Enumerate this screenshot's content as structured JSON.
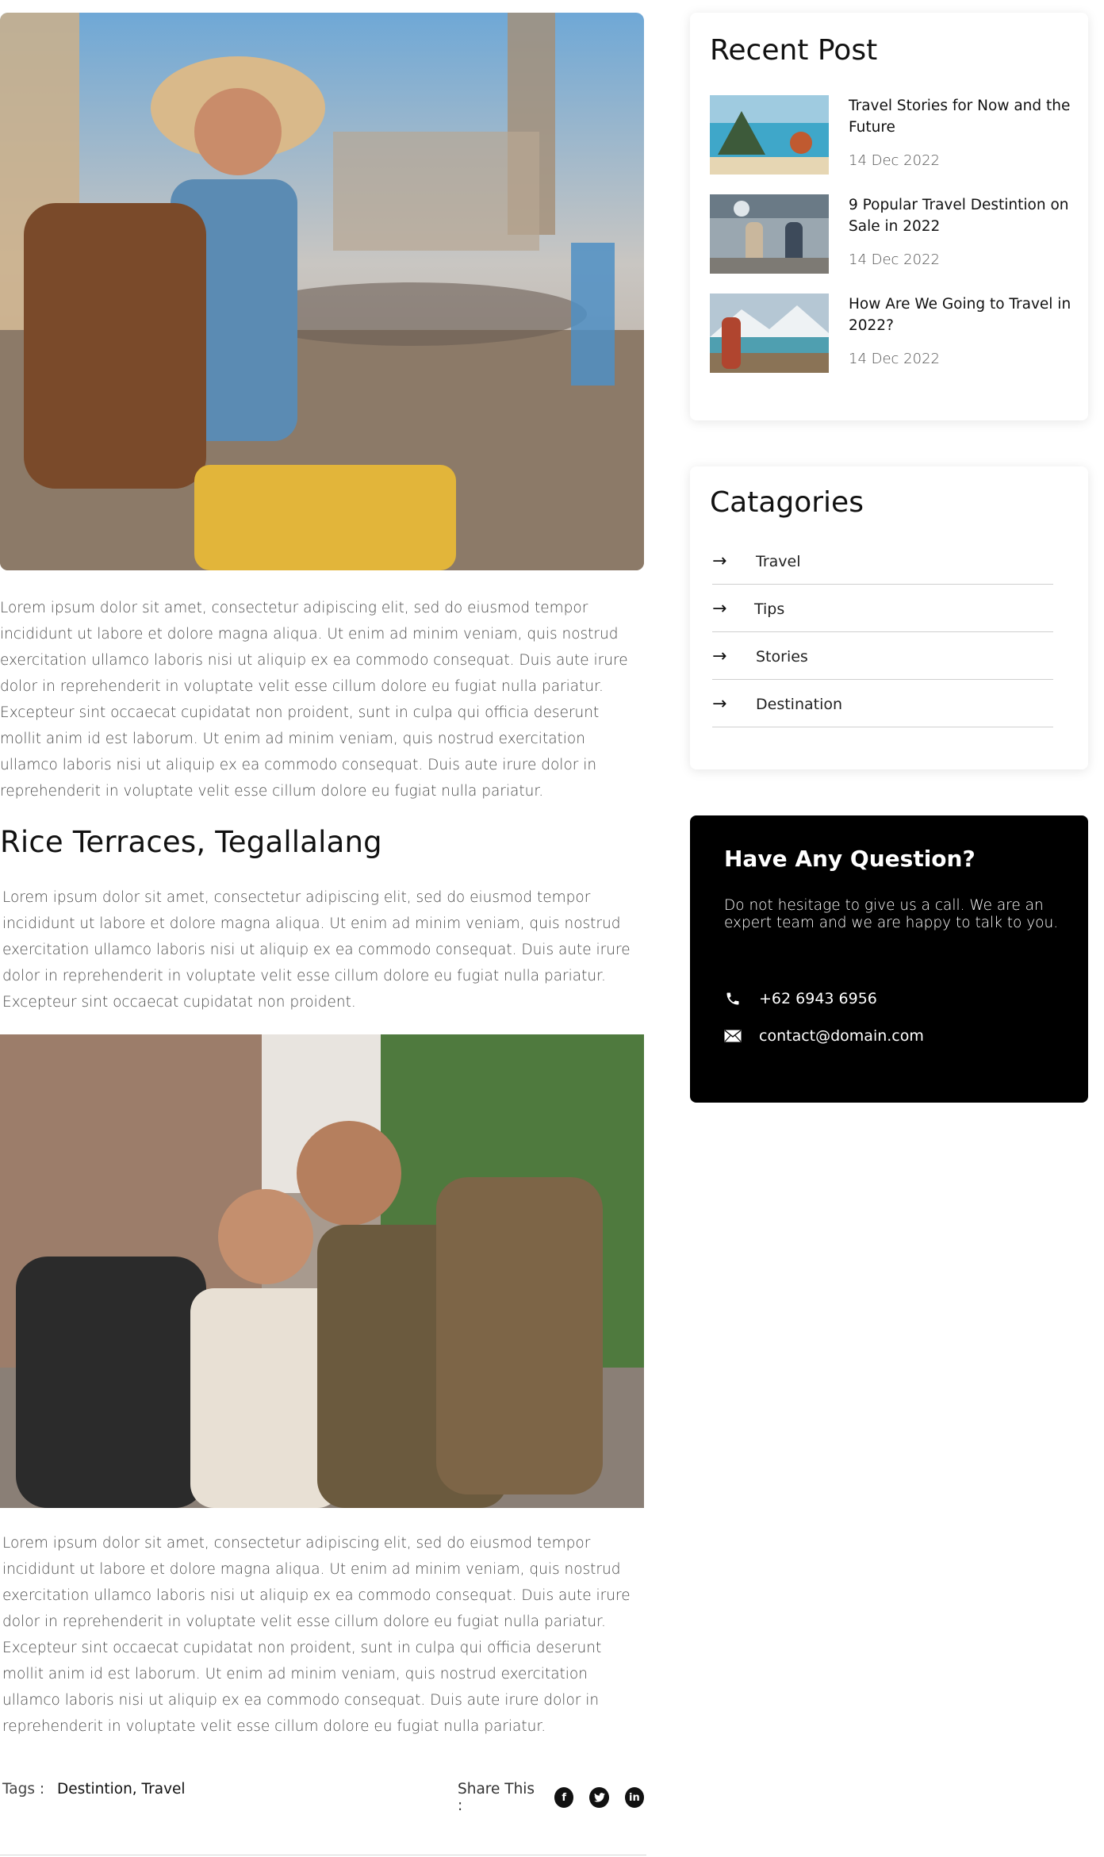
{
  "article": {
    "paragraph_1": "Lorem ipsum dolor sit amet, consectetur adipiscing elit, sed do eiusmod tempor incididunt ut labore et dolore magna aliqua. Ut enim ad minim veniam, quis nostrud exercitation ullamco laboris nisi ut aliquip ex ea commodo consequat. Duis aute irure dolor in reprehenderit in voluptate velit esse cillum dolore eu fugiat nulla pariatur. Excepteur sint occaecat cupidatat non proident, sunt in culpa qui officia deserunt mollit anim id est laborum. Ut enim ad minim veniam, quis nostrud exercitation ullamco laboris nisi ut aliquip ex ea commodo consequat. Duis aute irure dolor in reprehenderit in voluptate velit esse cillum dolore eu fugiat nulla pariatur.",
    "section_heading": "Rice Terraces, Tegallalang",
    "paragraph_2": "Lorem ipsum dolor sit amet, consectetur adipiscing elit, sed do eiusmod tempor incididunt ut labore et dolore magna aliqua. Ut enim ad minim veniam, quis nostrud exercitation ullamco laboris nisi ut aliquip ex ea commodo consequat. Duis aute irure dolor in reprehenderit in voluptate velit esse cillum dolore eu fugiat nulla pariatur. Excepteur sint occaecat cupidatat non proident.",
    "paragraph_3": "Lorem ipsum dolor sit amet, consectetur adipiscing elit, sed do eiusmod tempor incididunt ut labore et dolore magna aliqua. Ut enim ad minim veniam, quis nostrud exercitation ullamco laboris nisi ut aliquip ex ea commodo consequat. Duis aute irure dolor in reprehenderit in voluptate velit esse cillum dolore eu fugiat nulla pariatur. Excepteur sint occaecat cupidatat non proident, sunt in culpa qui officia deserunt mollit anim id est laborum. Ut enim ad minim veniam, quis nostrud exercitation ullamco laboris nisi ut aliquip ex ea commodo consequat. Duis aute irure dolor in reprehenderit in voluptate velit esse cillum dolore eu fugiat nulla pariatur."
  },
  "footer": {
    "tags_label": "Tags :",
    "tags_value": "Destintion, Travel",
    "share_label": "Share This :",
    "share_icons": [
      "facebook-icon",
      "twitter-icon",
      "linkedin-icon"
    ]
  },
  "recent": {
    "title": "Recent Post",
    "posts": [
      {
        "title": "Travel Stories for Now and the Future",
        "date": "14 Dec 2022"
      },
      {
        "title": "9 Popular Travel Destintion on Sale in 2022",
        "date": "14 Dec 2022"
      },
      {
        "title": "How Are We Going to Travel in 2022?",
        "date": "14 Dec 2022"
      }
    ]
  },
  "categories": {
    "title": "Catagories",
    "items": [
      {
        "label": "Travel"
      },
      {
        "label": "Tips"
      },
      {
        "label": "Stories"
      },
      {
        "label": "Destination"
      }
    ]
  },
  "question": {
    "title": "Have Any Question?",
    "body": "Do not hesitage to give us a call. We are an expert team and we are happy to talk to you.",
    "phone": "+62 6943 6956",
    "email": "contact@domain.com"
  },
  "colors": {
    "text": "#111111",
    "muted": "#4a4a4a",
    "card_dark": "#000000",
    "divider": "#cfcfcf"
  }
}
